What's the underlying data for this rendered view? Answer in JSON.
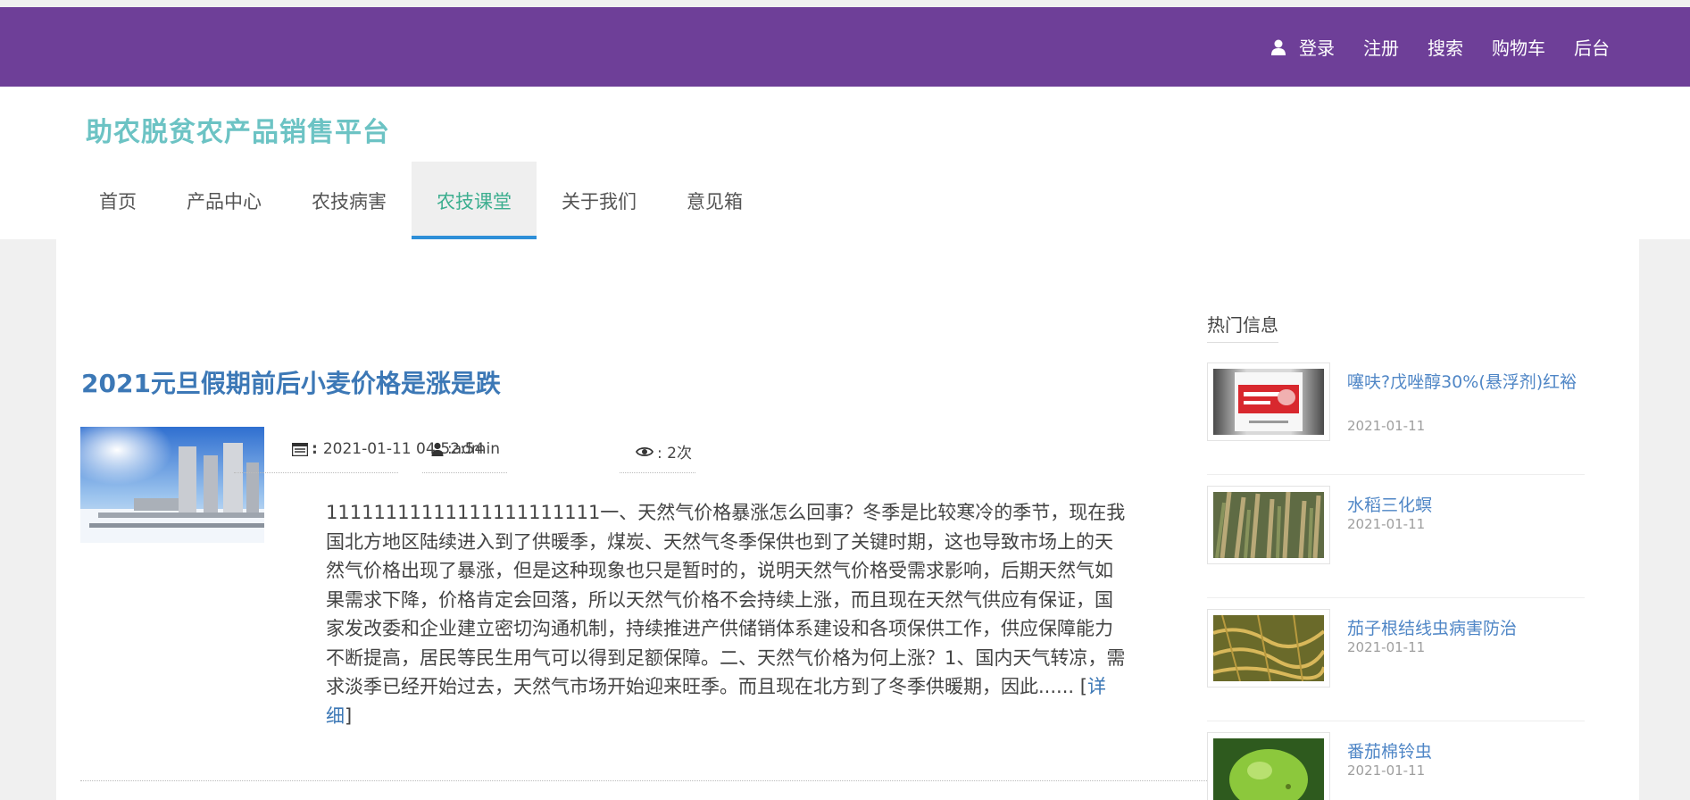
{
  "topnav": {
    "login": "登录",
    "register": "注册",
    "search": "搜索",
    "cart": "购物车",
    "admin": "后台"
  },
  "brand": "助农脱贫农产品销售平台",
  "mainnav": [
    {
      "label": "首页"
    },
    {
      "label": "产品中心"
    },
    {
      "label": "农技病害"
    },
    {
      "label": "农技课堂",
      "active": true
    },
    {
      "label": "关于我们"
    },
    {
      "label": "意见箱"
    }
  ],
  "article": {
    "title": "2021元旦假期前后小麦价格是涨是跌",
    "date": "2021-01-11 04:52:54",
    "author": ":admin",
    "views": ": 2次",
    "excerpt": "11111111111111111111111一、天然气价格暴涨怎么回事？冬季是比较寒冷的季节，现在我国北方地区陆续进入到了供暖季，煤炭、天然气冬季保供也到了关键时期，这也导致市场上的天然气价格出现了暴涨，但是这种现象也只是暂时的，说明天然气价格受需求影响，后期天然气如果需求下降，价格肯定会回落，所以天然气价格不会持续上涨，而且现在天然气供应有保证，国家发改委和企业建立密切沟通机制，持续推进产供储销体系建设和各项保供工作，供应保障能力不断提高，居民等民生用气可以得到足额保障。二、天然气价格为何上涨？1、国内天气转凉，需求淡季已经开始过去，天然气市场开始迎来旺季。而且现在北方到了冬季供暖期，因此...... ",
    "detail_link": "详细"
  },
  "sidebar": {
    "title": "热门信息",
    "items": [
      {
        "name": "噻呋?戊唑醇30%(悬浮剂)红裕",
        "date": "2021-01-11"
      },
      {
        "name": "水稻三化螟",
        "date": "2021-01-11"
      },
      {
        "name": "茄子根结线虫病害防治",
        "date": "2021-01-11"
      },
      {
        "name": "番茄棉铃虫",
        "date": "2021-01-11"
      }
    ]
  },
  "colors": {
    "topbar": "#6e3f98",
    "brand": "#6cc3c4",
    "nav_active_text": "#3cae8f",
    "nav_active_border": "#2e8fd8",
    "link": "#3c78b6"
  }
}
